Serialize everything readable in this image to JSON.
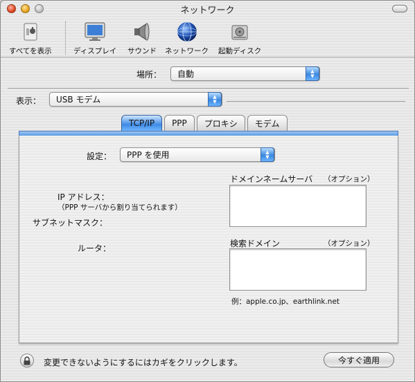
{
  "window": {
    "title": "ネットワーク"
  },
  "toolbar": {
    "items": [
      {
        "label": "すべてを表示",
        "icon": "apple-switch-icon"
      },
      {
        "label": "ディスプレイ",
        "icon": "display-icon"
      },
      {
        "label": "サウンド",
        "icon": "speaker-icon"
      },
      {
        "label": "ネットワーク",
        "icon": "globe-icon"
      },
      {
        "label": "起動ディスク",
        "icon": "hard-disk-icon"
      }
    ]
  },
  "location": {
    "label": "場所：",
    "value": "自動"
  },
  "show": {
    "label": "表示：",
    "value": "USB モデム"
  },
  "tabs": [
    {
      "label": "TCP/IP",
      "active": true
    },
    {
      "label": "PPP",
      "active": false
    },
    {
      "label": "プロキシ",
      "active": false
    },
    {
      "label": "モデム",
      "active": false
    }
  ],
  "tcpip": {
    "configure_label": "設定：",
    "configure_value": "PPP を使用",
    "ip_label": "IP アドレス：",
    "ip_note": "（PPP サーバから割り当てられます）",
    "subnet_label": "サブネットマスク：",
    "router_label": "ルータ：",
    "dns_label": "ドメインネームサーバ",
    "dns_optional": "（オプション）",
    "search_label": "検索ドメイン",
    "search_optional": "（オプション）",
    "example": "例：apple.co.jp、earthlink.net"
  },
  "footer": {
    "lock_text": "変更できないようにするにはカギをクリックします。",
    "apply_button": "今すぐ適用"
  },
  "colors": {
    "accent": "#3a88e0",
    "tab_active": "#3e8ae6"
  }
}
